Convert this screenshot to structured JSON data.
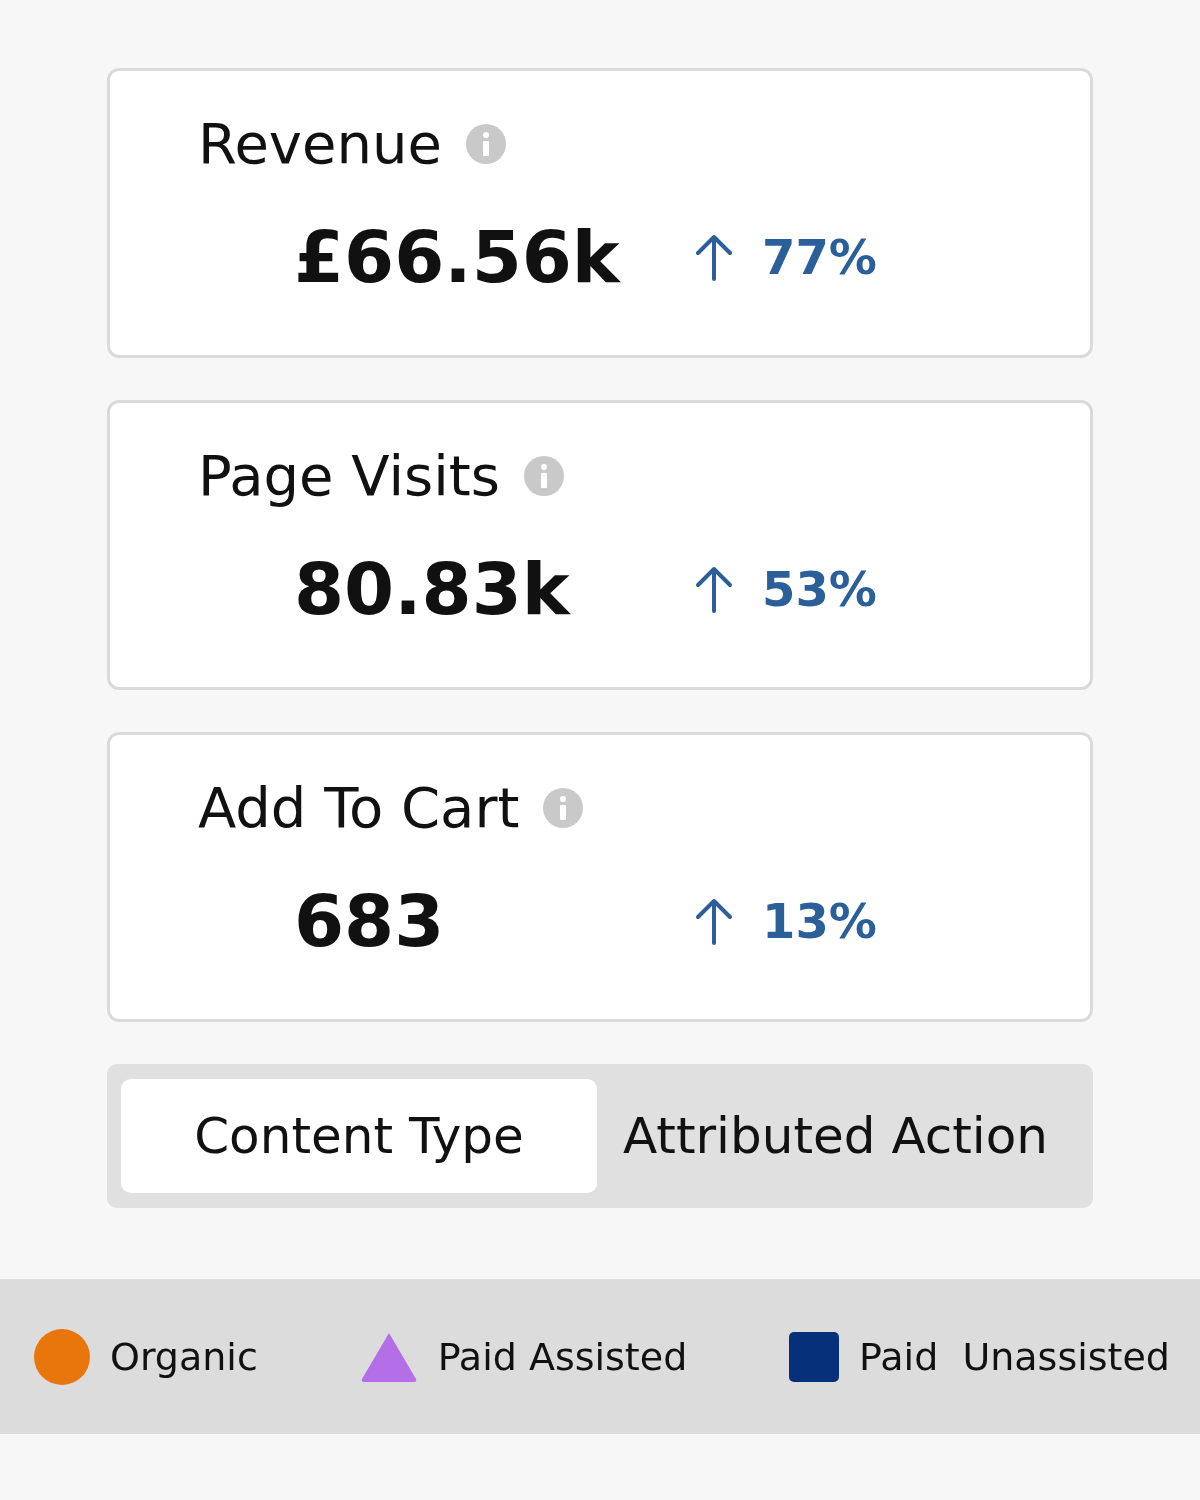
{
  "metrics": [
    {
      "title": "Revenue",
      "value": "£66.56k",
      "change": "77%",
      "increase": true
    },
    {
      "title": "Page Visits",
      "value": "80.83k",
      "change": "53%",
      "increase": true
    },
    {
      "title": "Add To Cart",
      "value": "683",
      "change": "13%",
      "increase": true
    }
  ],
  "tabs": [
    {
      "label": "Content Type",
      "selected": true
    },
    {
      "label": "Attributed Action",
      "selected": false
    }
  ],
  "legend": [
    {
      "label": "Organic",
      "kind": "circle",
      "color": "#e8760a"
    },
    {
      "label": "Paid Assisted",
      "kind": "triangle",
      "color": "#b36ee8"
    },
    {
      "label": "Paid  Unassisted",
      "kind": "square",
      "color": "#06307a"
    }
  ]
}
